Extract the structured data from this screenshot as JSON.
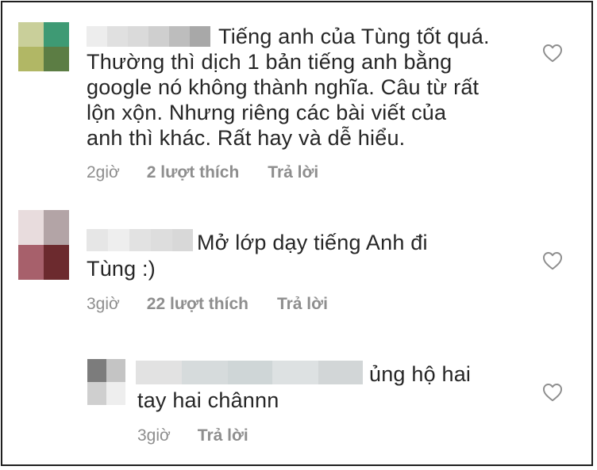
{
  "comments": [
    {
      "text": "Tiếng anh của Tùng tốt quá. Thường thì dịch 1 bản tiếng anh bằng google nó không thành nghĩa. Câu từ rất lộn xộn. Nhưng riêng các bài viết của anh thì khác. Rất hay và dễ hiểu.",
      "lines": [
        "Tiếng anh của Tùng tốt quá.",
        "Thường thì dịch 1 bản tiếng anh bằng",
        "google nó không thành nghĩa. Câu từ rất",
        "lộn xộn. Nhưng riêng các bài viết của",
        "anh thì khác. Rất hay và dễ hiểu."
      ],
      "time": "2giờ",
      "likes": "2 lượt thích",
      "reply": "Trả lời",
      "avatar_colors": [
        "#c9cf9a",
        "#3e9a74",
        "#b1b765",
        "#5c7d44"
      ],
      "blur_colors": [
        "#ededed",
        "#e0e0e0",
        "#dadada",
        "#cfcfcf",
        "#bdbdbd",
        "#a8a8a8"
      ]
    },
    {
      "text": "Mở lớp dạy tiếng Anh đi Tùng :)",
      "lines": [
        "Mở lớp dạy tiếng Anh đi",
        "Tùng :)"
      ],
      "time": "3giờ",
      "likes": "22 lượt thích",
      "reply": "Trả lời",
      "avatar_colors": [
        "#e8dcdd",
        "#b3a4a6",
        "#a7606b",
        "#6c2a2e"
      ],
      "blur_colors": [
        "#e6e6e6",
        "#eeeeee",
        "#e2e2e2",
        "#dddddd",
        "#d8d8d8"
      ]
    },
    {
      "text": "ủng hộ hai tay hai chânnn",
      "lines": [
        "ủng hộ hai",
        "tay hai chânnn"
      ],
      "time": "3giờ",
      "reply": "Trả lời",
      "avatar_colors": [
        "#7c7c7c",
        "#c4c4c4",
        "#cfcfcf",
        "#eeeeee"
      ],
      "blur_colors": [
        "#e2e2e2",
        "#d6dbdc",
        "#cfd6d7",
        "#dde1e2",
        "#d2d6d7"
      ]
    }
  ],
  "icons": {
    "like": "heart-outline-icon"
  },
  "colors": {
    "text": "#262626",
    "meta": "#8e8e8e",
    "border": "#1f1f1f"
  }
}
